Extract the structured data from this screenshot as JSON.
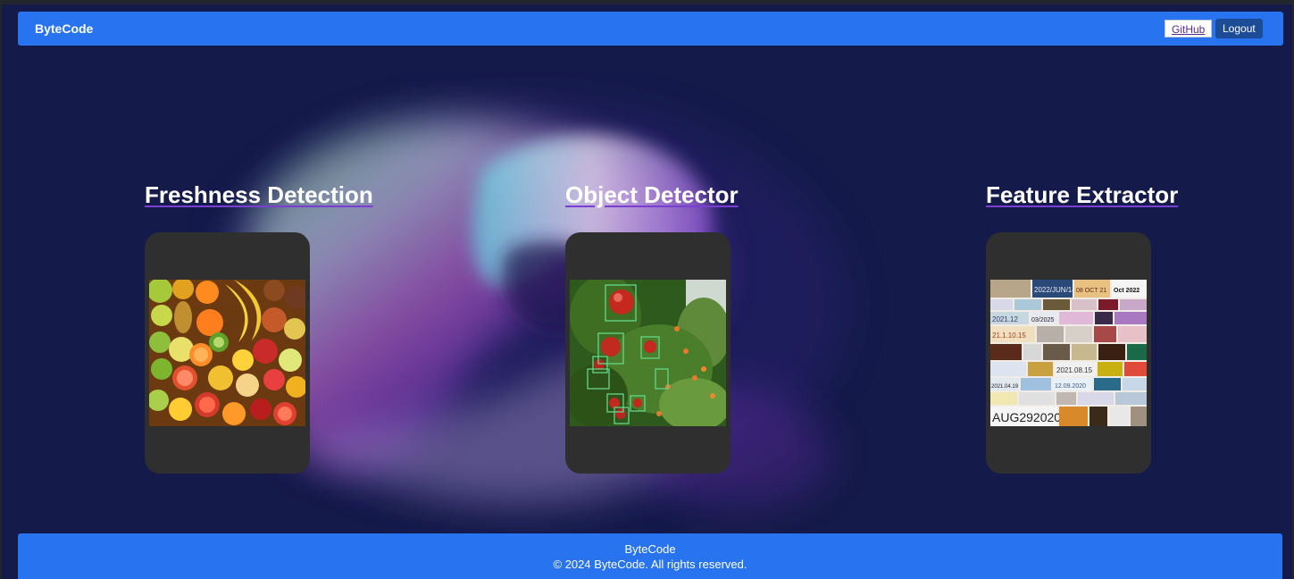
{
  "navbar": {
    "brand": "ByteCode",
    "github_label": "GitHub",
    "logout_label": "Logout"
  },
  "features": [
    {
      "title": "Freshness Detection",
      "image": "fruit-assortment"
    },
    {
      "title": "Object Detector",
      "image": "apple-tree-detections"
    },
    {
      "title": "Feature Extractor",
      "image": "date-text-crops"
    }
  ],
  "footer": {
    "brand": "ByteCode",
    "copyright": "© 2024 ByteCode. All rights reserved."
  },
  "thumb_texts": {
    "fe_row0": [
      "2022/JUN/14",
      "08 OCT 21",
      "Oct 2022"
    ],
    "fe_row1": [
      "2021.12",
      "03/2025"
    ],
    "fe_row2": [
      "21.1.10.15"
    ],
    "fe_row4": [
      "2021.08.15"
    ],
    "fe_row5": [
      "2021.04.19",
      "12.09.2020"
    ],
    "fe_row7": [
      "AUG292020"
    ]
  },
  "colors": {
    "navbar": "#2874f0",
    "page_background": "#141a4a",
    "card": "#2f2f2f",
    "logout_button": "#1d4c96",
    "title_underline": "#7a3fd0"
  }
}
